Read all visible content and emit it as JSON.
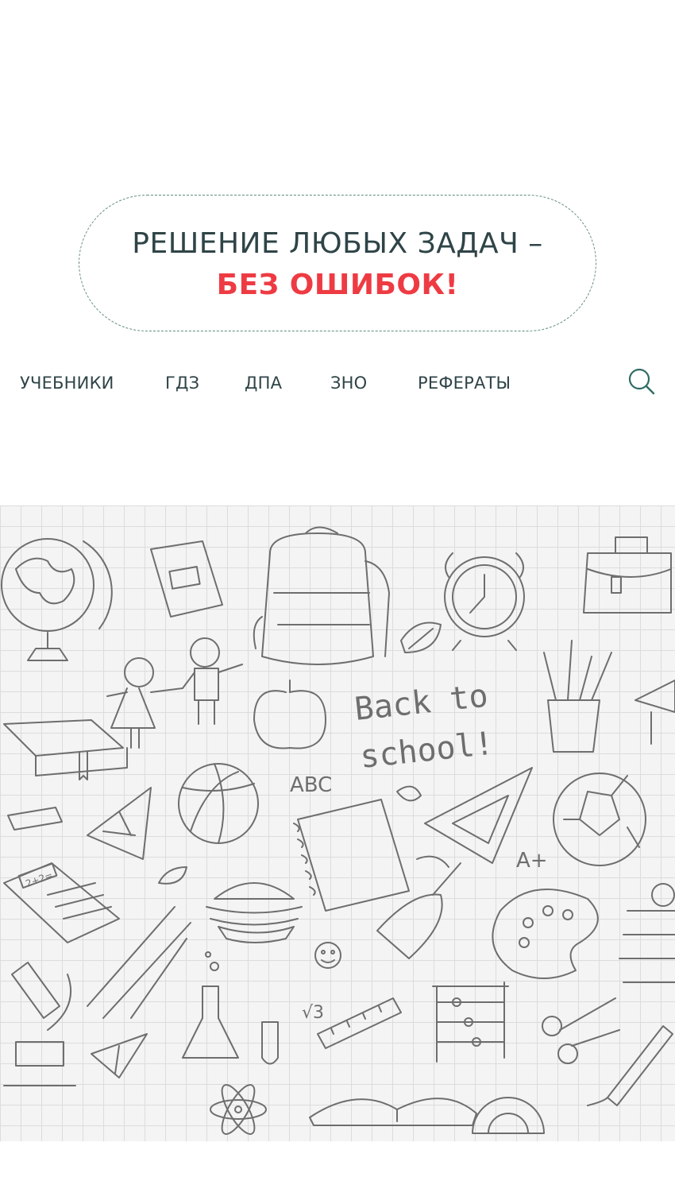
{
  "banner": {
    "line1": "РЕШЕНИЕ ЛЮБЫХ ЗАДАЧ –",
    "line2": "БЕЗ ОШИБОК!"
  },
  "nav": {
    "items": [
      {
        "label": "УЧЕБНИКИ"
      },
      {
        "label": "ГДЗ"
      },
      {
        "label": "ДПА"
      },
      {
        "label": "ЗНО"
      },
      {
        "label": "РЕФЕРАТЫ"
      }
    ],
    "search_icon": "search-icon"
  },
  "hero": {
    "texts": {
      "back_to": "Back to",
      "school": "school!",
      "abc": "ABC",
      "grade": "A+",
      "calc": "2+2=",
      "sqrt": "√3"
    }
  },
  "colors": {
    "heading": "#2f4447",
    "accent": "#ee3b43",
    "border": "#5f8a80"
  }
}
